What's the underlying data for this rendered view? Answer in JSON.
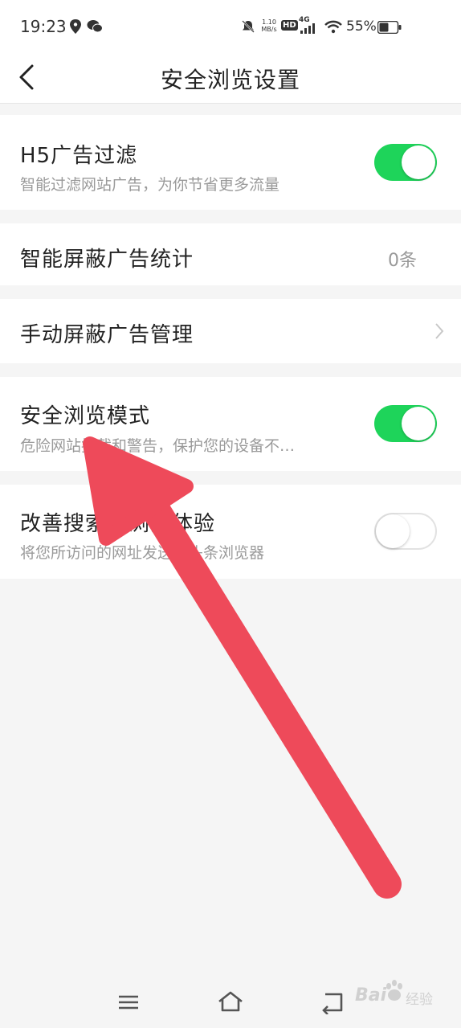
{
  "status_bar": {
    "time": "19:23",
    "net_speed_top": "1.10",
    "net_speed_bottom": "MB/s",
    "hd_label": "HD",
    "network": "4G",
    "battery": "55%"
  },
  "header": {
    "title": "安全浏览设置"
  },
  "settings": [
    {
      "title": "H5广告过滤",
      "subtitle": "智能过滤网站广告，为你节省更多流量",
      "toggle": true
    },
    {
      "title": "智能屏蔽广告统计",
      "value": "0条"
    },
    {
      "title": "手动屏蔽广告管理"
    },
    {
      "title": "安全浏览模式",
      "subtitle": "危险网站拦截和警告，保护您的设备不…",
      "toggle": true
    },
    {
      "title": "改善搜索和浏览体验",
      "subtitle": "将您所访问的网址发送给头条浏览器",
      "toggle": false
    }
  ],
  "watermark": {
    "text": "Bai",
    "text2": "经验"
  },
  "colors": {
    "toggle_on": "#1ed45a",
    "arrow": "#ee4a5a",
    "background": "#f5f5f5"
  }
}
